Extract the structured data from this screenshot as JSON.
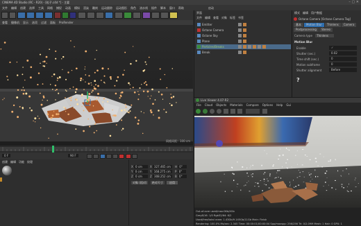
{
  "app": {
    "title": "CINEMA 4D Studio (RC - R20) - [粒子.c4d *] - 主要",
    "menu": [
      "文件",
      "编辑",
      "创建",
      "选择",
      "工具",
      "网格",
      "捕捉",
      "动画",
      "模拟",
      "渲染",
      "雕刻",
      "运动跟踪",
      "运动图形",
      "角色",
      "流水线",
      "插件",
      "脚本",
      "窗口",
      "帮助"
    ],
    "right_title": "界面",
    "right_layout": "启动"
  },
  "viewport": {
    "menu": [
      "查看",
      "摄像机",
      "显示",
      "选项",
      "过滤",
      "面板",
      "ProRender"
    ],
    "grid_readout": "网格间距：100 cm"
  },
  "object_manager": {
    "menu": [
      "文件",
      "编辑",
      "查看",
      "对象",
      "标签",
      "书签"
    ],
    "items": [
      "Emitter",
      "Octane Camera",
      "Octane Sky",
      "Plane",
      "Particles/Breaks",
      "Break"
    ]
  },
  "attributes": {
    "menu": [
      "模式",
      "编辑",
      "用户数据"
    ],
    "header": "Octane Camera [Octane Camera Tag]",
    "tabs": [
      "基本",
      "Motion Blur",
      "Thinlens",
      "Camera",
      "Postprocessing",
      "Stereo"
    ],
    "camera_type_label": "Camera type",
    "camera_type_value": "Thinlens",
    "section": "Motion Blur",
    "rows": [
      {
        "label": "Enable",
        "value": "✓"
      },
      {
        "label": "Shutter (sec.)",
        "value": "0.02"
      },
      {
        "label": "Time shift (sec.)",
        "value": "0"
      },
      {
        "label": "Motion subframe",
        "value": "0"
      },
      {
        "label": "Shutter alignment",
        "value": "Before"
      }
    ],
    "help": "?"
  },
  "timeline": {
    "start": "0 F",
    "end": "90 F",
    "current": "20 F"
  },
  "coords": {
    "x_pos": "0 cm",
    "y_pos": "0 cm",
    "z_pos": "0 cm",
    "x_size": "327.465 cm",
    "y_size": "168.275 cm",
    "z_size": "308.252 cm",
    "h": "0°",
    "p": "0°",
    "b": "0°",
    "mode": "对象 (相对)",
    "size_mode": "绝对尺寸",
    "apply": "应用"
  },
  "materials": {
    "menu": [
      "创建",
      "编辑",
      "功能",
      "纹理"
    ]
  },
  "live_viewer": {
    "title": "Live Viewer 4.07-R2",
    "menu": [
      "File",
      "Cloud",
      "Objects",
      "Materials",
      "Compare",
      "Options",
      "Help",
      "Gui"
    ],
    "status": [
      "Out-of-core used/max:0Kb/4Gb",
      "Grey8/16: 1/0          Rgb32/64: 6/2",
      "Used/free/total vram: 1.43Gb/9.145Gb/11Gb   Main: Finish",
      "Rendering: 100.0%  Ms/sec: 2.345  Time: 00:00:01/00:00:04  Spp/maxspp: 256/256  Tri: 0/2.09M  Mesh: 1  Hair: 0  GPU: 1"
    ]
  },
  "colors": {
    "accent_blue": "#2f6fb0",
    "orange_tab": "#c48a2a",
    "selected_row": "#4a6a8a",
    "red_icon": "#c03030",
    "green_marker": "#2fbf6a"
  }
}
